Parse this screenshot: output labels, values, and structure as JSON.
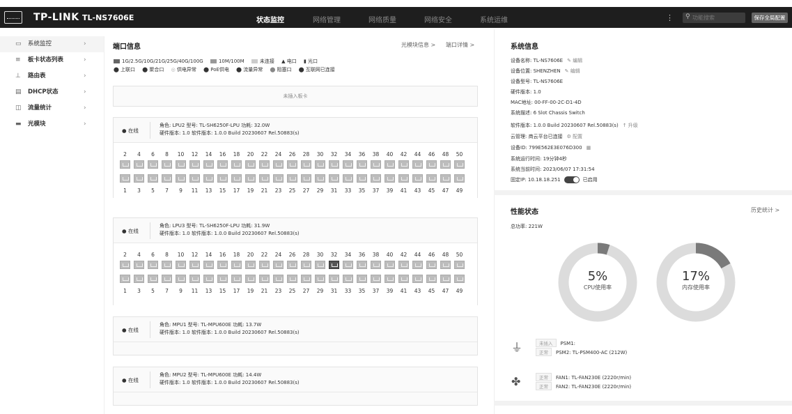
{
  "topbar": {
    "brand": "TP-LINK",
    "model": "TL-NS7606E",
    "nav": [
      "状态监控",
      "网络管理",
      "网络质量",
      "网络安全",
      "系统运维"
    ],
    "search_placeholder": "功能搜索",
    "save_label": "保存全局配置"
  },
  "sidebar": {
    "items": [
      {
        "label": "系统监控",
        "icon": "monitor-icon"
      },
      {
        "label": "板卡状态列表",
        "icon": "list-icon"
      },
      {
        "label": "路由表",
        "icon": "route-icon"
      },
      {
        "label": "DHCP状态",
        "icon": "dhcp-icon"
      },
      {
        "label": "流量统计",
        "icon": "chart-icon"
      },
      {
        "label": "光模块",
        "icon": "module-icon"
      }
    ]
  },
  "ports": {
    "title": "端口信息",
    "link_optical": "光模块信息 >",
    "link_detail": "端口详情 >",
    "legend_row1": [
      "1G/2.5G/10G/21G/25G/40G/100G",
      "10M/100M",
      "未连接",
      "电口",
      "光口"
    ],
    "legend_row2": [
      "上联口",
      "聚合口",
      "供电异常",
      "PoE供电",
      "流量异常",
      "阻塞口",
      "互联网已连接"
    ],
    "empty_slot": "未插入板卡",
    "cards": [
      {
        "status": "在线",
        "line1": "角色: LPU2    型号: TL-SH6250F-LPU    功耗: 32.0W",
        "line2": "硬件版本: 1.0    软件版本: 1.0.0 Build 20230607 Rel.50883(s)"
      },
      {
        "status": "在线",
        "line1": "角色: LPU3    型号: TL-SH6250F-LPU    功耗: 31.9W",
        "line2": "硬件版本: 1.0    软件版本: 1.0.0 Build 20230607 Rel.50883(s)"
      },
      {
        "status": "在线",
        "line1": "角色: MPU1    型号: TL-MPU600E    功耗: 13.7W",
        "line2": "硬件版本: 1.0    软件版本: 1.0.0 Build 20230607 Rel.50883(s)"
      },
      {
        "status": "在线",
        "line1": "角色: MPU2    型号: TL-MPU600E    功耗: 14.4W",
        "line2": "硬件版本: 1.0    软件版本: 1.0.0 Build 20230607 Rel.50883(s)"
      }
    ],
    "even_numbers": [
      "2",
      "4",
      "6",
      "8",
      "10",
      "12",
      "14",
      "16",
      "18",
      "20",
      "22",
      "24",
      "26",
      "28",
      "30",
      "32",
      "34",
      "36",
      "38",
      "40",
      "42",
      "44",
      "46",
      "48",
      "50"
    ],
    "odd_numbers": [
      "1",
      "3",
      "5",
      "7",
      "9",
      "11",
      "13",
      "15",
      "17",
      "19",
      "21",
      "23",
      "25",
      "27",
      "29",
      "31",
      "33",
      "35",
      "37",
      "39",
      "41",
      "43",
      "45",
      "47",
      "49"
    ],
    "active_ports_card2": [
      "32"
    ]
  },
  "system": {
    "title": "系统信息",
    "edit_label": "编辑",
    "upgrade_label": "升级",
    "config_label": "配置",
    "enabled_label": "已启用",
    "rows": [
      "设备名称: TL-NS7606E",
      "设备位置: SHENZHEN",
      "设备型号: TL-NS7606E",
      "硬件版本: 1.0",
      "MAC地址: 00-FF-00-2C-D1-4D",
      "系统描述: 6 Slot Chassis Switch",
      "软件版本: 1.0.0 Build 20230607 Rel.50883(s)",
      "云管理: 商云平台已连接",
      "设备ID: 799E562E3E076D300",
      "系统运行时间: 19分钟4秒",
      "系统当前时间: 2023/06/07 17:31:54",
      "固定IP: 10.18.18.251"
    ]
  },
  "performance": {
    "title": "性能状态",
    "history_link": "历史统计 >",
    "total_power": "总功率: 221W",
    "cpu": {
      "value": "5%",
      "label": "CPU使用率",
      "fraction": 0.05
    },
    "mem": {
      "value": "17%",
      "label": "内存使用率",
      "fraction": 0.17
    },
    "psu": [
      {
        "tag": "未插入",
        "text": "PSM1:"
      },
      {
        "tag": "正常",
        "text": "PSM2: TL-PSM400-AC (212W)"
      }
    ],
    "fans": [
      {
        "tag": "正常",
        "text": "FAN1: TL-FAN230E (2220r/min)"
      },
      {
        "tag": "正常",
        "text": "FAN2: TL-FAN230E (2220r/min)"
      }
    ],
    "colors": {
      "accent": "#7a7a7a",
      "track": "#dcdcdc"
    }
  }
}
